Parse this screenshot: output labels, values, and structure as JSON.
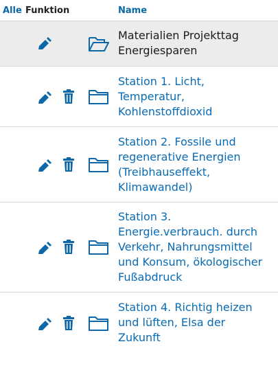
{
  "header": {
    "select_all": "Alle",
    "function": "Funktion",
    "name": "Name"
  },
  "colors": {
    "accent": "#0b67a8",
    "text": "#1b1b1b",
    "highlight_row": "#ececec"
  },
  "rows": [
    {
      "name": "Materialien Projekttag\nEnergiesparen",
      "actions": [
        "edit-icon",
        "folder-open-icon"
      ]
    },
    {
      "name": "Station 1. Licht,\nTemperatur,\nKohlenstoffdioxid",
      "actions": [
        "edit-icon",
        "trash-icon",
        "folder-icon"
      ]
    },
    {
      "name": "Station 2. Fossile und\nregenerative Energien\n(Treibhauseffekt,\nKlimawandel)",
      "actions": [
        "edit-icon",
        "trash-icon",
        "folder-icon"
      ]
    },
    {
      "name": "Station 3.\nEnergie.verbrauch. durch\nVerkehr, Nahrungsmittel\nund Konsum, ökologischer\nFußabdruck",
      "actions": [
        "edit-icon",
        "trash-icon",
        "folder-icon"
      ]
    },
    {
      "name": "Station 4. Richtig heizen\nund lüften, Elsa der\nZukunft",
      "actions": [
        "edit-icon",
        "trash-icon",
        "folder-icon"
      ]
    }
  ]
}
